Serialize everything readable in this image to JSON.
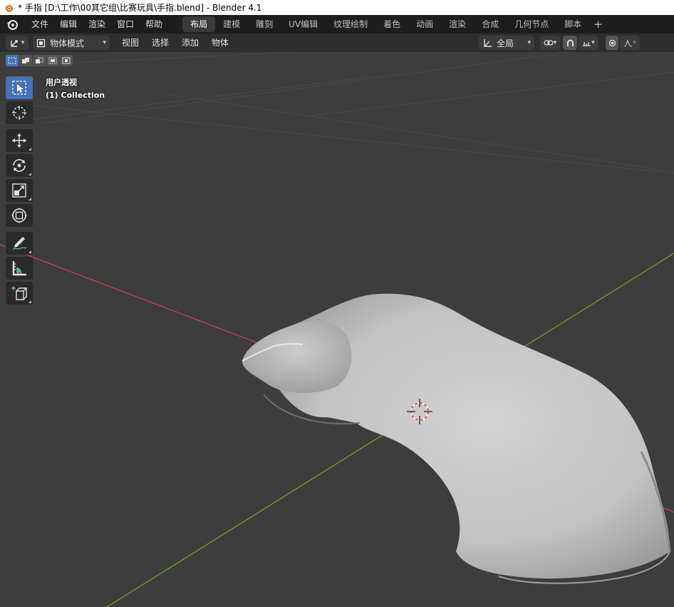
{
  "window": {
    "title": "* 手指 [D:\\工作\\00其它组\\比赛玩具\\手指.blend] - Blender 4.1"
  },
  "topbar": {
    "menus": [
      "文件",
      "编辑",
      "渲染",
      "窗口",
      "帮助"
    ],
    "workspaces": [
      {
        "label": "布局",
        "active": true
      },
      {
        "label": "建模",
        "active": false
      },
      {
        "label": "雕刻",
        "active": false
      },
      {
        "label": "UV编辑",
        "active": false
      },
      {
        "label": "纹理绘制",
        "active": false
      },
      {
        "label": "着色",
        "active": false
      },
      {
        "label": "动画",
        "active": false
      },
      {
        "label": "渲染",
        "active": false
      },
      {
        "label": "合成",
        "active": false
      },
      {
        "label": "几何节点",
        "active": false
      },
      {
        "label": "脚本",
        "active": false
      }
    ],
    "add_workspace": "+"
  },
  "viewport_header": {
    "mode": "物体模式",
    "menus": [
      "视图",
      "选择",
      "添加",
      "物体"
    ],
    "transform_orientation": "全局"
  },
  "viewport": {
    "view_name": "用户透视",
    "collection": "(1) Collection"
  },
  "toolbar": {
    "tools": [
      "select-box-tool",
      "cursor-tool",
      "move-tool",
      "rotate-tool",
      "scale-tool",
      "transform-tool",
      "annotate-tool",
      "measure-tool",
      "add-cube-tool"
    ]
  },
  "colors": {
    "x_axis": "#b5474f",
    "y_axis": "#6f9a2c",
    "accent": "#4772b3",
    "object": "#c9c9c9"
  }
}
